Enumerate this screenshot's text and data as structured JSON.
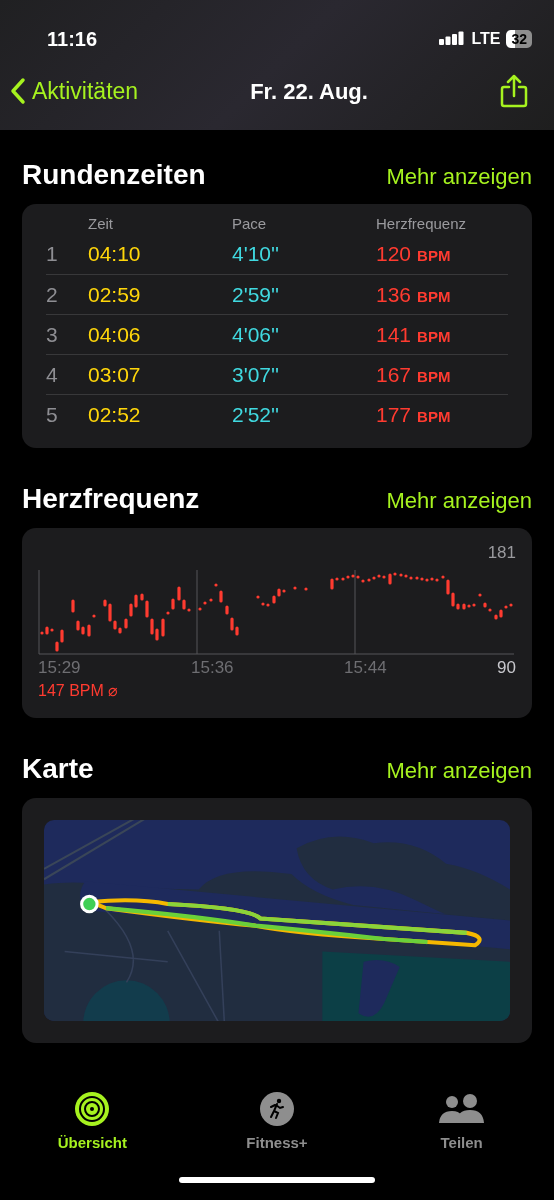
{
  "status_bar": {
    "time": "11:16",
    "network": "LTE",
    "battery": "32"
  },
  "nav": {
    "back": "Aktivitäten",
    "title": "Fr. 22. Aug."
  },
  "splits": {
    "title": "Rundenzeiten",
    "more": "Mehr anzeigen",
    "columns": [
      "Zeit",
      "Pace",
      "Herzfrequenz"
    ],
    "rows": [
      {
        "index": "1",
        "time": "04:10",
        "pace": "4'10''",
        "heart_rate": "120",
        "unit": "BPM"
      },
      {
        "index": "2",
        "time": "02:59",
        "pace": "2'59''",
        "heart_rate": "136",
        "unit": "BPM"
      },
      {
        "index": "3",
        "time": "04:06",
        "pace": "4'06''",
        "heart_rate": "141",
        "unit": "BPM"
      },
      {
        "index": "4",
        "time": "03:07",
        "pace": "3'07''",
        "heart_rate": "167",
        "unit": "BPM"
      },
      {
        "index": "5",
        "time": "02:52",
        "pace": "2'52''",
        "heart_rate": "177",
        "unit": "BPM"
      }
    ]
  },
  "heart_rate": {
    "title": "Herzfrequenz",
    "more": "Mehr anzeigen",
    "max": "181",
    "min": "90",
    "times": [
      "15:29",
      "15:36",
      "15:44"
    ],
    "average": "147 BPM ⌀"
  },
  "map": {
    "title": "Karte",
    "more": "Mehr anzeigen"
  },
  "tabs": [
    {
      "label": "Übersicht",
      "selected": true
    },
    {
      "label": "Fitness+",
      "selected": false
    },
    {
      "label": "Teilen",
      "selected": false
    }
  ]
}
